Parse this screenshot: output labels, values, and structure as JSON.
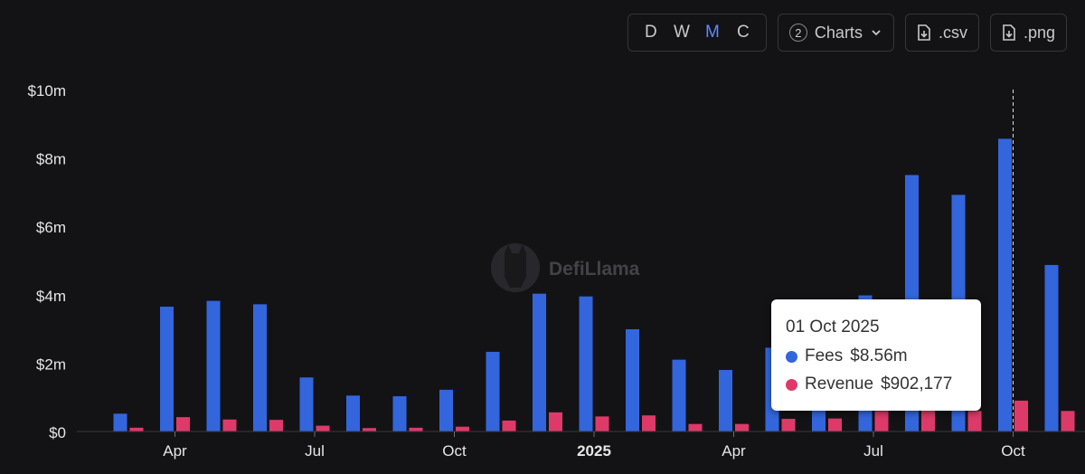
{
  "toolbar": {
    "granularity": [
      "D",
      "W",
      "M",
      "C"
    ],
    "active": "M",
    "charts_count": "2",
    "charts_label": "Charts",
    "csv_label": ".csv",
    "png_label": ".png"
  },
  "watermark": "DefiLlama",
  "tooltip": {
    "date": "01 Oct 2025",
    "fees_label": "Fees",
    "fees_value": "$8.56m",
    "revenue_label": "Revenue",
    "revenue_value": "$902,177"
  },
  "colors": {
    "fees": "#3366dd",
    "revenue": "#dd3a6a"
  },
  "chart_data": {
    "type": "bar",
    "categories": [
      "2024-03",
      "2024-04",
      "2024-05",
      "2024-06",
      "2024-07",
      "2024-08",
      "2024-09",
      "2024-10",
      "2024-11",
      "2024-12",
      "2025-01",
      "2025-02",
      "2025-03",
      "2025-04",
      "2025-05",
      "2025-06",
      "2025-07",
      "2025-08",
      "2025-09",
      "2025-10",
      "2025-11"
    ],
    "series": [
      {
        "name": "Fees",
        "values": [
          0.52,
          3.65,
          3.82,
          3.72,
          1.58,
          1.05,
          1.03,
          1.22,
          2.33,
          4.03,
          3.95,
          2.99,
          2.1,
          1.8,
          2.45,
          2.9,
          3.98,
          7.5,
          6.92,
          8.56,
          4.87
        ]
      },
      {
        "name": "Revenue",
        "values": [
          0.11,
          0.42,
          0.35,
          0.34,
          0.17,
          0.1,
          0.11,
          0.14,
          0.32,
          0.56,
          0.44,
          0.47,
          0.22,
          0.22,
          0.37,
          0.38,
          0.6,
          0.65,
          0.6,
          0.902177,
          0.6
        ]
      }
    ],
    "y_unit": "$m",
    "ylim": [
      0,
      10
    ],
    "y_ticks": [
      "$0",
      "$2m",
      "$4m",
      "$6m",
      "$8m",
      "$10m"
    ],
    "x_ticks": [
      {
        "label": "Apr",
        "month": "2024-04"
      },
      {
        "label": "Jul",
        "month": "2024-07"
      },
      {
        "label": "Oct",
        "month": "2024-10"
      },
      {
        "label": "2025",
        "month": "2025-01",
        "bold": true
      },
      {
        "label": "Apr",
        "month": "2025-04"
      },
      {
        "label": "Jul",
        "month": "2025-07"
      },
      {
        "label": "Oct",
        "month": "2025-10"
      }
    ],
    "highlighted_category": "2025-10",
    "grid": false,
    "legend": "tooltip"
  }
}
